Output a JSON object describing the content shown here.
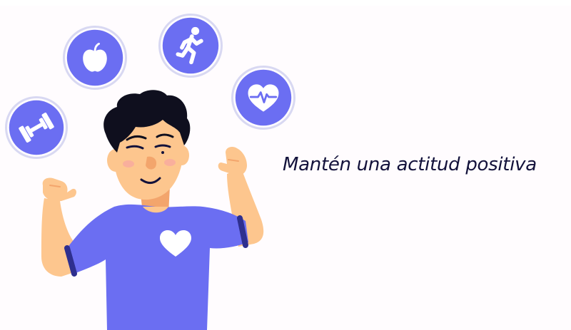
{
  "colors": {
    "accent": "#6b6ef2",
    "accent_dark": "#2e2f8f",
    "skin": "#fdc68e",
    "skin_shadow": "#f3a56c",
    "hair": "#0f0f1e",
    "text": "#13123b",
    "white": "#ffffff"
  },
  "icons": [
    "dumbbell-icon",
    "apple-icon",
    "running-person-icon",
    "heart-pulse-icon",
    "heart-icon"
  ],
  "headline": "Mantén una actitud positiva"
}
